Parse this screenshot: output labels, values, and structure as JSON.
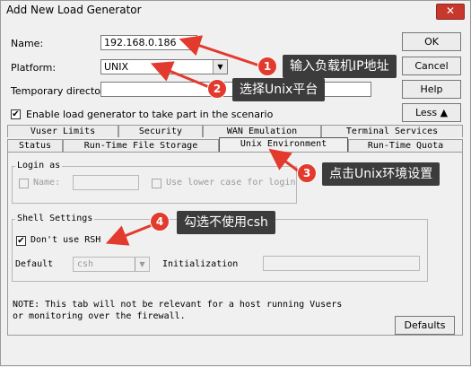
{
  "window": {
    "title": "Add New Load Generator",
    "close_glyph": "✕"
  },
  "form": {
    "name_label": "Name:",
    "name_value": "192.168.0.186",
    "platform_label": "Platform:",
    "platform_value": "UNIX",
    "tempdir_label": "Temporary directory:",
    "tempdir_value": "",
    "enable_label": "Enable load generator to take part in the scenario",
    "enable_checked": true
  },
  "buttons": {
    "ok": "OK",
    "cancel": "Cancel",
    "help": "Help",
    "less": "Less ▲",
    "defaults": "Defaults"
  },
  "tabs": {
    "row1": [
      "Vuser Limits",
      "Security",
      "WAN Emulation",
      "Terminal Services"
    ],
    "row2": [
      "Status",
      "Run-Time File Storage",
      "Unix Environment",
      "Run-Time Quota"
    ],
    "active": "Unix Environment"
  },
  "login": {
    "group_title": "Login as",
    "name_label": "Name:",
    "lowercase_label": "Use lower case for login"
  },
  "shell": {
    "group_title": "Shell Settings",
    "dont_use_rsh_label": "Don't use RSH",
    "dont_use_rsh_checked": true,
    "default_label": "Default",
    "default_value": "csh",
    "init_label": "Initialization"
  },
  "note": {
    "line1": "NOTE: This tab will not be relevant for a host running Vusers",
    "line2": "or monitoring over the firewall."
  },
  "annotations": [
    {
      "num": "1",
      "text": "输入负载机IP地址"
    },
    {
      "num": "2",
      "text": "选择Unix平台"
    },
    {
      "num": "3",
      "text": "点击Unix环境设置"
    },
    {
      "num": "4",
      "text": "勾选不使用csh"
    }
  ],
  "colors": {
    "annotation_red": "#e23b2e",
    "callout_bg": "#3c3c3c"
  }
}
